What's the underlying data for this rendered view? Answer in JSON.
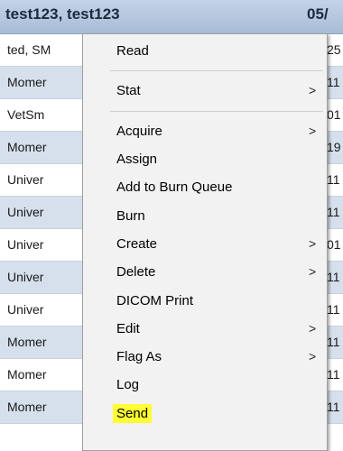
{
  "header": {
    "patient_name": "test123, test123",
    "date_partial": "05/"
  },
  "worklist": {
    "rows": [
      {
        "institution": "ted, SM",
        "trailing": "25"
      },
      {
        "institution": "Momer",
        "trailing": "11"
      },
      {
        "institution": "VetSm",
        "trailing": "01"
      },
      {
        "institution": "Momer",
        "trailing": "19"
      },
      {
        "institution": "Univer",
        "trailing": "11"
      },
      {
        "institution": "Univer",
        "trailing": "11"
      },
      {
        "institution": "Univer",
        "trailing": "01"
      },
      {
        "institution": "Univer",
        "trailing": "11"
      },
      {
        "institution": "Univer",
        "trailing": "11"
      },
      {
        "institution": "Momer",
        "trailing": "11"
      },
      {
        "institution": "Momer",
        "trailing": "11"
      },
      {
        "institution": "Momer",
        "trailing": "11"
      }
    ]
  },
  "context_menu": {
    "submenu_arrow": ">",
    "items": [
      {
        "label": "Read"
      },
      {
        "label": "Stat"
      },
      {
        "label": "Acquire"
      },
      {
        "label": "Assign"
      },
      {
        "label": "Add to Burn Queue"
      },
      {
        "label": "Burn"
      },
      {
        "label": "Create"
      },
      {
        "label": "Delete"
      },
      {
        "label": "DICOM Print"
      },
      {
        "label": "Edit"
      },
      {
        "label": "Flag As"
      },
      {
        "label": "Log"
      },
      {
        "label": "Send"
      }
    ],
    "highlight_color": "#ffff33"
  }
}
